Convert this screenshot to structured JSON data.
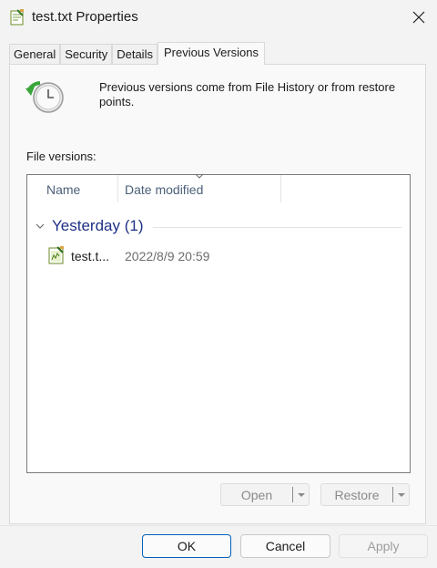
{
  "window": {
    "title": "test.txt Properties"
  },
  "tabs": [
    {
      "label": "General"
    },
    {
      "label": "Security"
    },
    {
      "label": "Details"
    },
    {
      "label": "Previous Versions"
    }
  ],
  "active_tab": "Previous Versions",
  "description": "Previous versions come from File History or from restore points.",
  "file_versions_label": "File versions:",
  "columns": {
    "name": "Name",
    "date": "Date modified"
  },
  "group": {
    "label": "Yesterday (1)"
  },
  "files": [
    {
      "name": "test.t...",
      "date": "2022/8/9 20:59",
      "icon": "text-file-icon"
    }
  ],
  "actions": {
    "open_label": "Open",
    "restore_label": "Restore"
  },
  "footer": {
    "ok_label": "OK",
    "cancel_label": "Cancel",
    "apply_label": "Apply"
  },
  "colors": {
    "accent": "#005fb8",
    "group_text": "#1e3287",
    "disabled_text": "#8a8a8a"
  }
}
